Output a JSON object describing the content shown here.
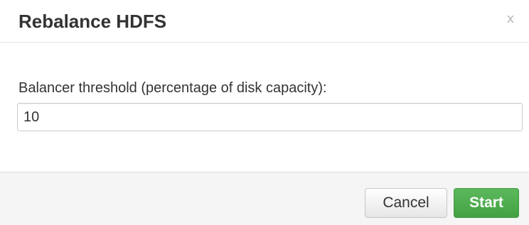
{
  "dialog": {
    "title": "Rebalance HDFS",
    "close_label": "x"
  },
  "form": {
    "threshold_label": "Balancer threshold (percentage of disk capacity):",
    "threshold_value": "10"
  },
  "footer": {
    "cancel_label": "Cancel",
    "start_label": "Start"
  },
  "colors": {
    "start_button": "#5cb85c",
    "footer_background": "#f5f5f5"
  }
}
